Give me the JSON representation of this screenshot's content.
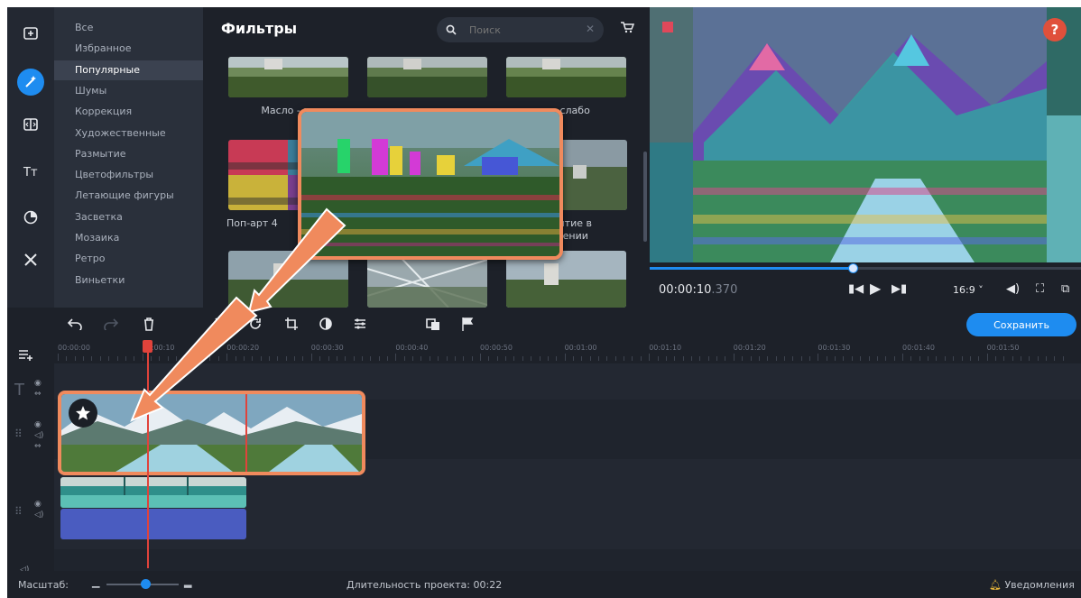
{
  "rail": {
    "items": [
      {
        "name": "import-icon"
      },
      {
        "name": "magic-wand-icon",
        "active": true
      },
      {
        "name": "transitions-icon"
      },
      {
        "name": "titles-icon"
      },
      {
        "name": "stickers-icon"
      },
      {
        "name": "tools-icon"
      }
    ]
  },
  "categories": [
    "Все",
    "Избранное",
    "Популярные",
    "Шумы",
    "Коррекция",
    "Художественные",
    "Размытие",
    "Цветофильтры",
    "Летающие фигуры",
    "Засветка",
    "Мозаика",
    "Ретро",
    "Виньетки"
  ],
  "categories_active_index": 2,
  "gallery": {
    "title": "Фильтры",
    "search_placeholder": "Поиск",
    "labels": {
      "row1_left": "Масло - м",
      "row1_right": "- слабо",
      "row2_left": "Поп-арт 4",
      "row2_right_line1": "ытие в",
      "row2_right_line2": "кении"
    }
  },
  "player": {
    "time_main": "00:00:10",
    "time_ms": ".370",
    "aspect": "16:9 ˅",
    "progress": 0.47,
    "help": "?"
  },
  "toolbar": {
    "save_label": "Сохранить"
  },
  "timeline": {
    "ticks": [
      "00:00:00",
      "00:00:10",
      "00:00:20",
      "00:00:30",
      "00:00:40",
      "00:00:50",
      "00:01:00",
      "00:01:10",
      "00:01:20",
      "00:01:30",
      "00:01:40",
      "00:01:50"
    ]
  },
  "statusbar": {
    "scale_label": "Масштаб:",
    "duration": "Длительность проекта: 00:22",
    "notifications": "Уведомления"
  },
  "colors": {
    "accent": "#1e8cf0",
    "highlight": "#f08a5d",
    "playhead": "#e0433b",
    "background": "#1d2129"
  }
}
